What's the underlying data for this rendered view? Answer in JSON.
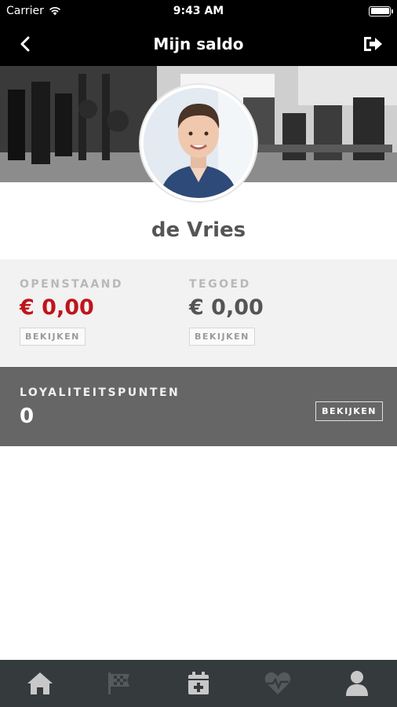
{
  "status_bar": {
    "carrier": "Carrier",
    "time": "9:43 AM"
  },
  "nav": {
    "title": "Mijn saldo"
  },
  "user": {
    "name": "de Vries"
  },
  "balance": {
    "openstaand": {
      "label": "OPENSTAAND",
      "value": "€ 0,00",
      "button": "BEKIJKEN",
      "color": "#c0141c"
    },
    "tegoed": {
      "label": "TEGOED",
      "value": "€ 0,00",
      "button": "BEKIJKEN",
      "color": "#555555"
    }
  },
  "loyalty": {
    "label": "LOYALITEITSPUNTEN",
    "value": "0",
    "button": "BEKIJKEN"
  },
  "tabs": [
    {
      "icon": "home-icon",
      "active": true
    },
    {
      "icon": "race-flag-icon",
      "active": false
    },
    {
      "icon": "calendar-plus-icon",
      "active": true
    },
    {
      "icon": "heart-pulse-icon",
      "active": false
    },
    {
      "icon": "user-icon",
      "active": true
    }
  ],
  "colors": {
    "tab_active": "#c8c8c8",
    "tab_inactive": "#555b5c",
    "accent_red": "#c0141c"
  }
}
